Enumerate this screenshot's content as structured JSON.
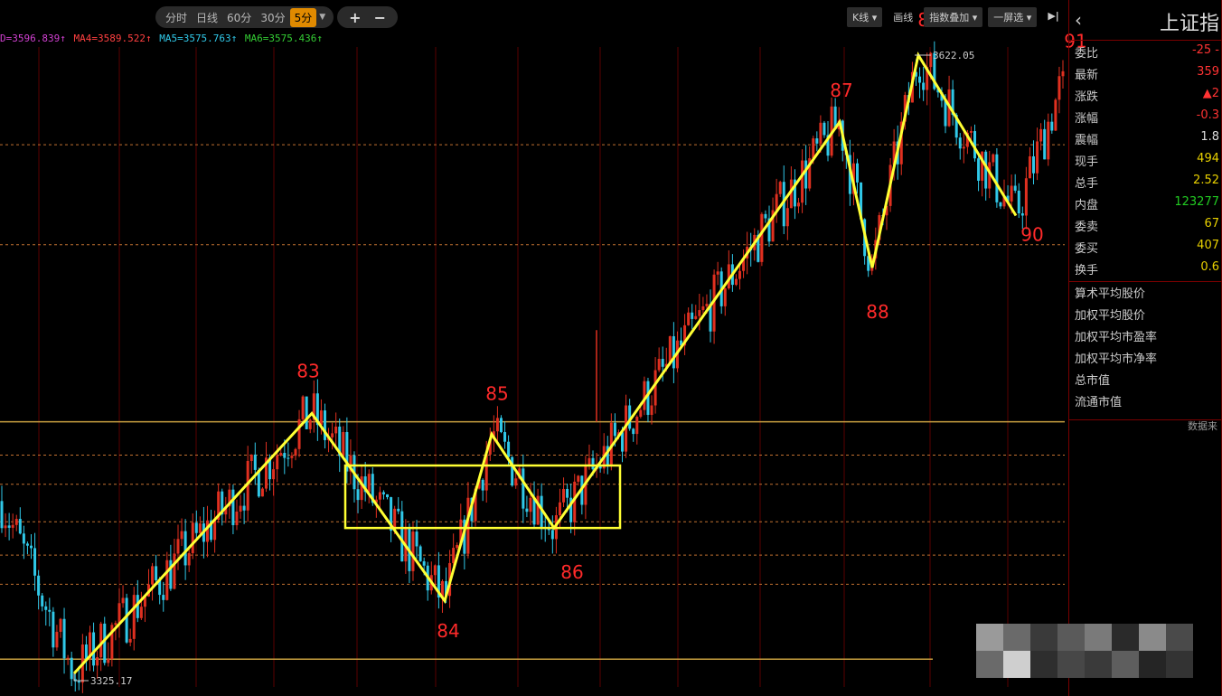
{
  "toolbar": {
    "periods": [
      "分时",
      "日线",
      "60分",
      "30分",
      "5分"
    ],
    "active_period": "5分",
    "zoom_in": "+",
    "zoom_out": "−"
  },
  "ma_line": {
    "ma1": "D=3596.839↑",
    "ma2": "MA4=3589.522↑",
    "ma3": "MA5=3575.763↑",
    "ma4": "MA6=3575.436↑"
  },
  "right_toolbar": {
    "kline": "K线",
    "draw": "画线",
    "overlay": "指数叠加",
    "select": "一屏选"
  },
  "sidebar": {
    "title": "上证指",
    "quotes": [
      {
        "label": "委比",
        "value": "-25 -",
        "color": "#ff3333"
      },
      {
        "label": "最新",
        "value": "359",
        "color": "#ff3333"
      },
      {
        "label": "涨跌",
        "value": "▲2",
        "color": "#ff3333"
      },
      {
        "label": "涨幅",
        "value": "-0.3",
        "color": "#ff3333"
      },
      {
        "label": "震幅",
        "value": "1.8",
        "color": "#dddddd"
      },
      {
        "label": "现手",
        "value": "494",
        "color": "#e8d000"
      },
      {
        "label": "总手",
        "value": "2.52",
        "color": "#e8d000"
      },
      {
        "label": "内盘",
        "value": "123277",
        "color": "#22cc22"
      },
      {
        "label": "委卖",
        "value": "67",
        "color": "#e8d000"
      },
      {
        "label": "委买",
        "value": "407",
        "color": "#e8d000"
      },
      {
        "label": "换手",
        "value": "0.6",
        "color": "#e8d000"
      }
    ],
    "stats": [
      "算术平均股价",
      "加权平均股价",
      "加权平均市盈率",
      "加权平均市净率",
      "总市值",
      "流通市值"
    ],
    "note": "数据来"
  },
  "chart_data": {
    "type": "line",
    "price_high_label": "3622.05",
    "price_low_label": "3325.17",
    "wave_points": [
      {
        "label": "",
        "index": 0,
        "price": 3325.17
      },
      {
        "label": "83",
        "index": 1,
        "price": 3450
      },
      {
        "label": "84",
        "index": 2,
        "price": 3360
      },
      {
        "label": "85",
        "index": 3,
        "price": 3440
      },
      {
        "label": "86",
        "index": 4,
        "price": 3395
      },
      {
        "label": "87",
        "index": 5,
        "price": 3590
      },
      {
        "label": "88",
        "index": 6,
        "price": 3520
      },
      {
        "label": "89",
        "index": 7,
        "price": 3622.05
      },
      {
        "label": "90",
        "index": 8,
        "price": 3545
      },
      {
        "label": "91",
        "index": 9,
        "price": 3605
      }
    ],
    "consolidation_box": {
      "from_label": "84",
      "to_label": "86",
      "price_top": 3425,
      "price_bottom": 3395
    },
    "support_lines": [
      3332,
      3446
    ],
    "dotted_levels": [
      3368,
      3382,
      3398,
      3416,
      3430,
      3531,
      3579
    ],
    "wave_color": "#ffff33",
    "label_color": "#ff2a2a",
    "bull_color": "#e03020",
    "bear_color": "#30c8e8"
  }
}
